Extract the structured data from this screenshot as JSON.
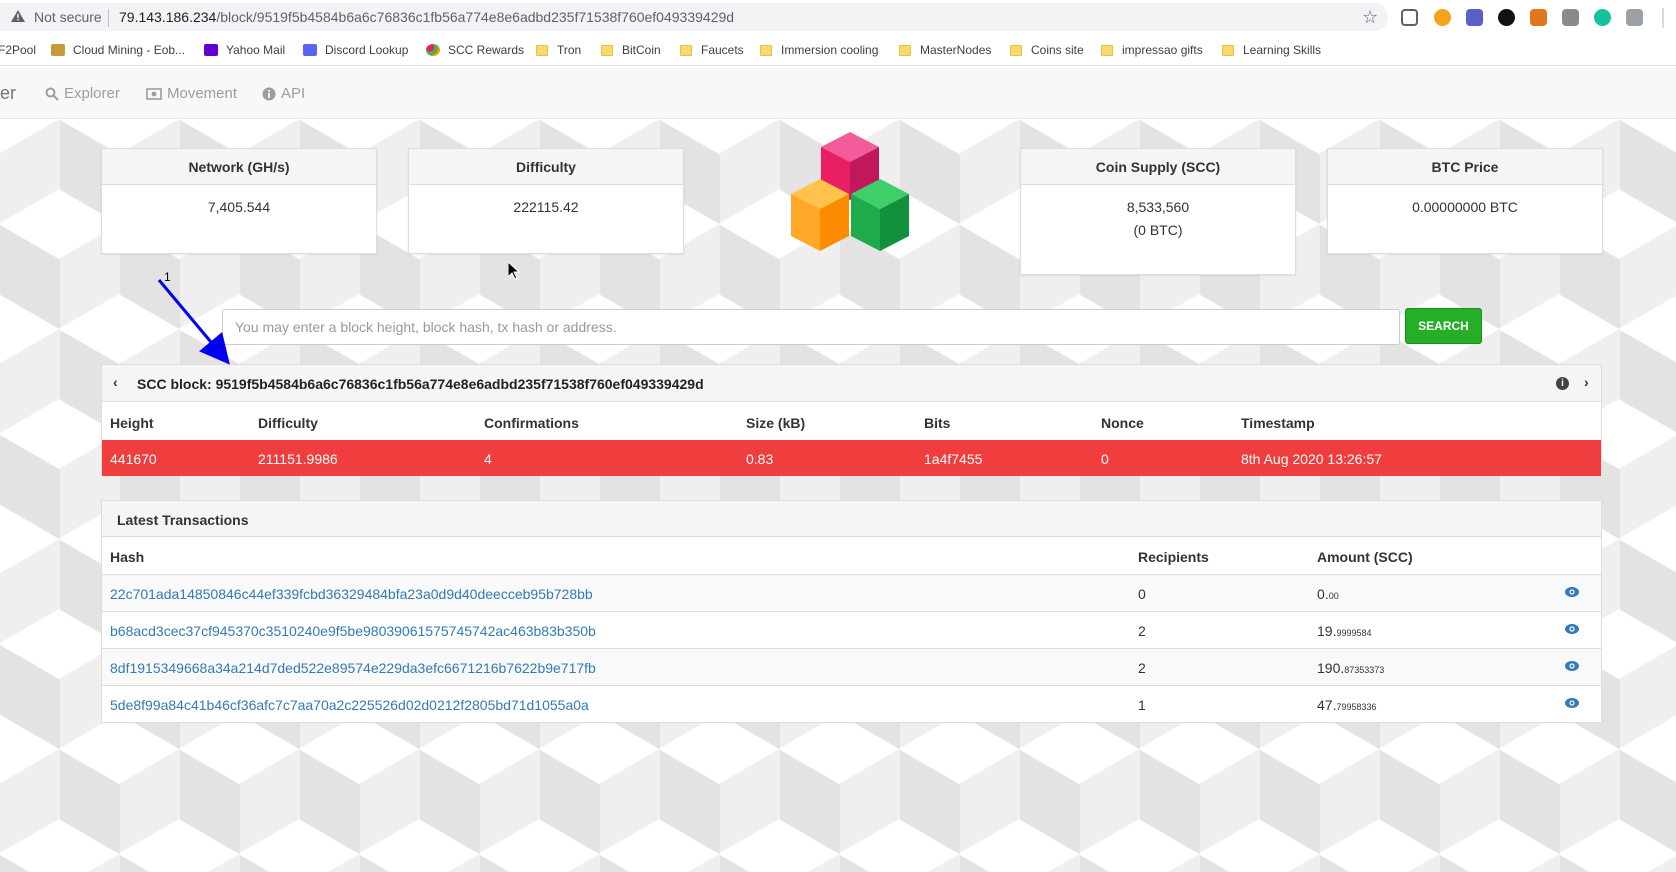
{
  "browser": {
    "security_label": "Not secure",
    "url_host": "79.143.186.234",
    "url_path": "/block/9519f5b4584b6a6c76836c1fb56a774e8e6adbd235f71538f760ef049339429d",
    "bookmarks": [
      {
        "label": "F2Pool",
        "icon": "none"
      },
      {
        "label": "Cloud Mining - Eob...",
        "icon": "favicon"
      },
      {
        "label": "Yahoo Mail",
        "icon": "yahoo-icon"
      },
      {
        "label": "Discord Lookup",
        "icon": "discord-icon"
      },
      {
        "label": "SCC Rewards",
        "icon": "scc-icon"
      },
      {
        "label": "Tron",
        "icon": "folder-icon"
      },
      {
        "label": "BitCoin",
        "icon": "folder-icon"
      },
      {
        "label": "Faucets",
        "icon": "folder-icon"
      },
      {
        "label": "Immersion cooling",
        "icon": "folder-icon"
      },
      {
        "label": "MasterNodes",
        "icon": "folder-icon"
      },
      {
        "label": "Coins site",
        "icon": "folder-icon"
      },
      {
        "label": "impressao gifts",
        "icon": "folder-icon"
      },
      {
        "label": "Learning Skills",
        "icon": "folder-icon"
      }
    ]
  },
  "nav": {
    "brand_fragment": "er",
    "items": [
      {
        "label": "Explorer",
        "icon": "search-icon"
      },
      {
        "label": "Movement",
        "icon": "money-icon"
      },
      {
        "label": "API",
        "icon": "info-icon"
      }
    ]
  },
  "stats": {
    "network": {
      "title": "Network (GH/s)",
      "value": "7,405.544"
    },
    "difficulty": {
      "title": "Difficulty",
      "value": "222115.42"
    },
    "supply": {
      "title": "Coin Supply (SCC)",
      "value": "8,533,560",
      "sub": "(0 BTC)"
    },
    "price": {
      "title": "BTC Price",
      "value": "0.00000000 BTC"
    }
  },
  "search": {
    "placeholder": "You may enter a block height, block hash, tx hash or address.",
    "button": "SEARCH"
  },
  "block": {
    "title_prefix": "SCC block:",
    "hash": "9519f5b4584b6a6c76836c1fb56a774e8e6adbd235f71538f760ef049339429d",
    "columns": [
      "Height",
      "Difficulty",
      "Confirmations",
      "Size (kB)",
      "Bits",
      "Nonce",
      "Timestamp"
    ],
    "row": [
      "441670",
      "211151.9986",
      "4",
      "0.83",
      "1a4f7455",
      "0",
      "8th Aug 2020 13:26:57"
    ],
    "row_color": "#f03e3e"
  },
  "transactions": {
    "title": "Latest Transactions",
    "columns": [
      "Hash",
      "Recipients",
      "Amount (SCC)"
    ],
    "rows": [
      {
        "hash": "22c701ada14850846c44ef339fcbd36329484bfa23a0d9d40deecceb95b728bb",
        "recipients": "0",
        "amount_int": "0.",
        "amount_dec": "00"
      },
      {
        "hash": "b68acd3cec37cf945370c3510240e9f5be98039061575745742ac463b83b350b",
        "recipients": "2",
        "amount_int": "19.",
        "amount_dec": "9999584"
      },
      {
        "hash": "8df1915349668a34a214d7ded522e89574e229da3efc6671216b7622b9e717fb",
        "recipients": "2",
        "amount_int": "190.",
        "amount_dec": "87353373"
      },
      {
        "hash": "5de8f99a84c41b46cf36afc7c7aa70a2c225526d02d0212f2805bd71d1055a0a",
        "recipients": "1",
        "amount_int": "47.",
        "amount_dec": "79958336"
      }
    ]
  },
  "annotation": {
    "number": "1",
    "arrow_color": "#0000ee"
  },
  "colors": {
    "accent_link": "#337ab7",
    "search_button": "#27ae27"
  }
}
